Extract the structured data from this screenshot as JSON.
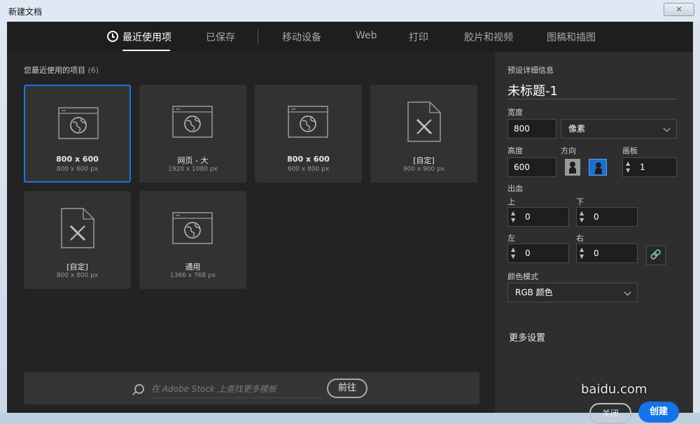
{
  "window": {
    "title": "新建文档",
    "close_glyph": "✕"
  },
  "tabs": [
    {
      "label": "最近使用项",
      "active": true
    },
    {
      "label": "已保存",
      "active": false
    },
    {
      "label": "移动设备",
      "active": false
    },
    {
      "label": "Web",
      "active": false
    },
    {
      "label": "打印",
      "active": false
    },
    {
      "label": "胶片和视频",
      "active": false
    },
    {
      "label": "图稿和插图",
      "active": false
    }
  ],
  "recent": {
    "title": "您最近使用的项目",
    "count": "(6)",
    "items": [
      {
        "name": "800 x 600",
        "dims": "800 x 600 px",
        "icon": "web-globe-icon",
        "selected": true
      },
      {
        "name": "网页 - 大",
        "dims": "1920 x 1080 px",
        "icon": "web-globe-icon",
        "selected": false
      },
      {
        "name": "800 x 600",
        "dims": "600 x 800 px",
        "icon": "web-globe-icon",
        "selected": false
      },
      {
        "name": "[自定]",
        "dims": "900 x 900 px",
        "icon": "document-pencil-icon",
        "selected": false
      },
      {
        "name": "[自定]",
        "dims": "800 x 800 px",
        "icon": "document-pencil-icon",
        "selected": false
      },
      {
        "name": "通用",
        "dims": "1366 x 768 px",
        "icon": "web-globe-icon",
        "selected": false
      }
    ]
  },
  "search": {
    "placeholder": "在 Adobe Stock 上查找更多模板",
    "go_label": "前往"
  },
  "details": {
    "section_title": "预设详细信息",
    "doc_name": "未标题-1",
    "width_label": "宽度",
    "width_value": "800",
    "unit": "像素",
    "height_label": "高度",
    "height_value": "600",
    "orientation_label": "方向",
    "artboard_label": "画板",
    "artboard_value": "1",
    "bleed_label": "出血",
    "top_label": "上",
    "top_value": "0",
    "bottom_label": "下",
    "bottom_value": "0",
    "left_label": "左",
    "left_value": "0",
    "right_label": "右",
    "right_value": "0",
    "color_mode_label": "颜色模式",
    "color_mode_value": "RGB 颜色",
    "more_settings": "更多设置",
    "close_label": "关闭",
    "create_label": "创建"
  },
  "watermark": "baidu.com"
}
